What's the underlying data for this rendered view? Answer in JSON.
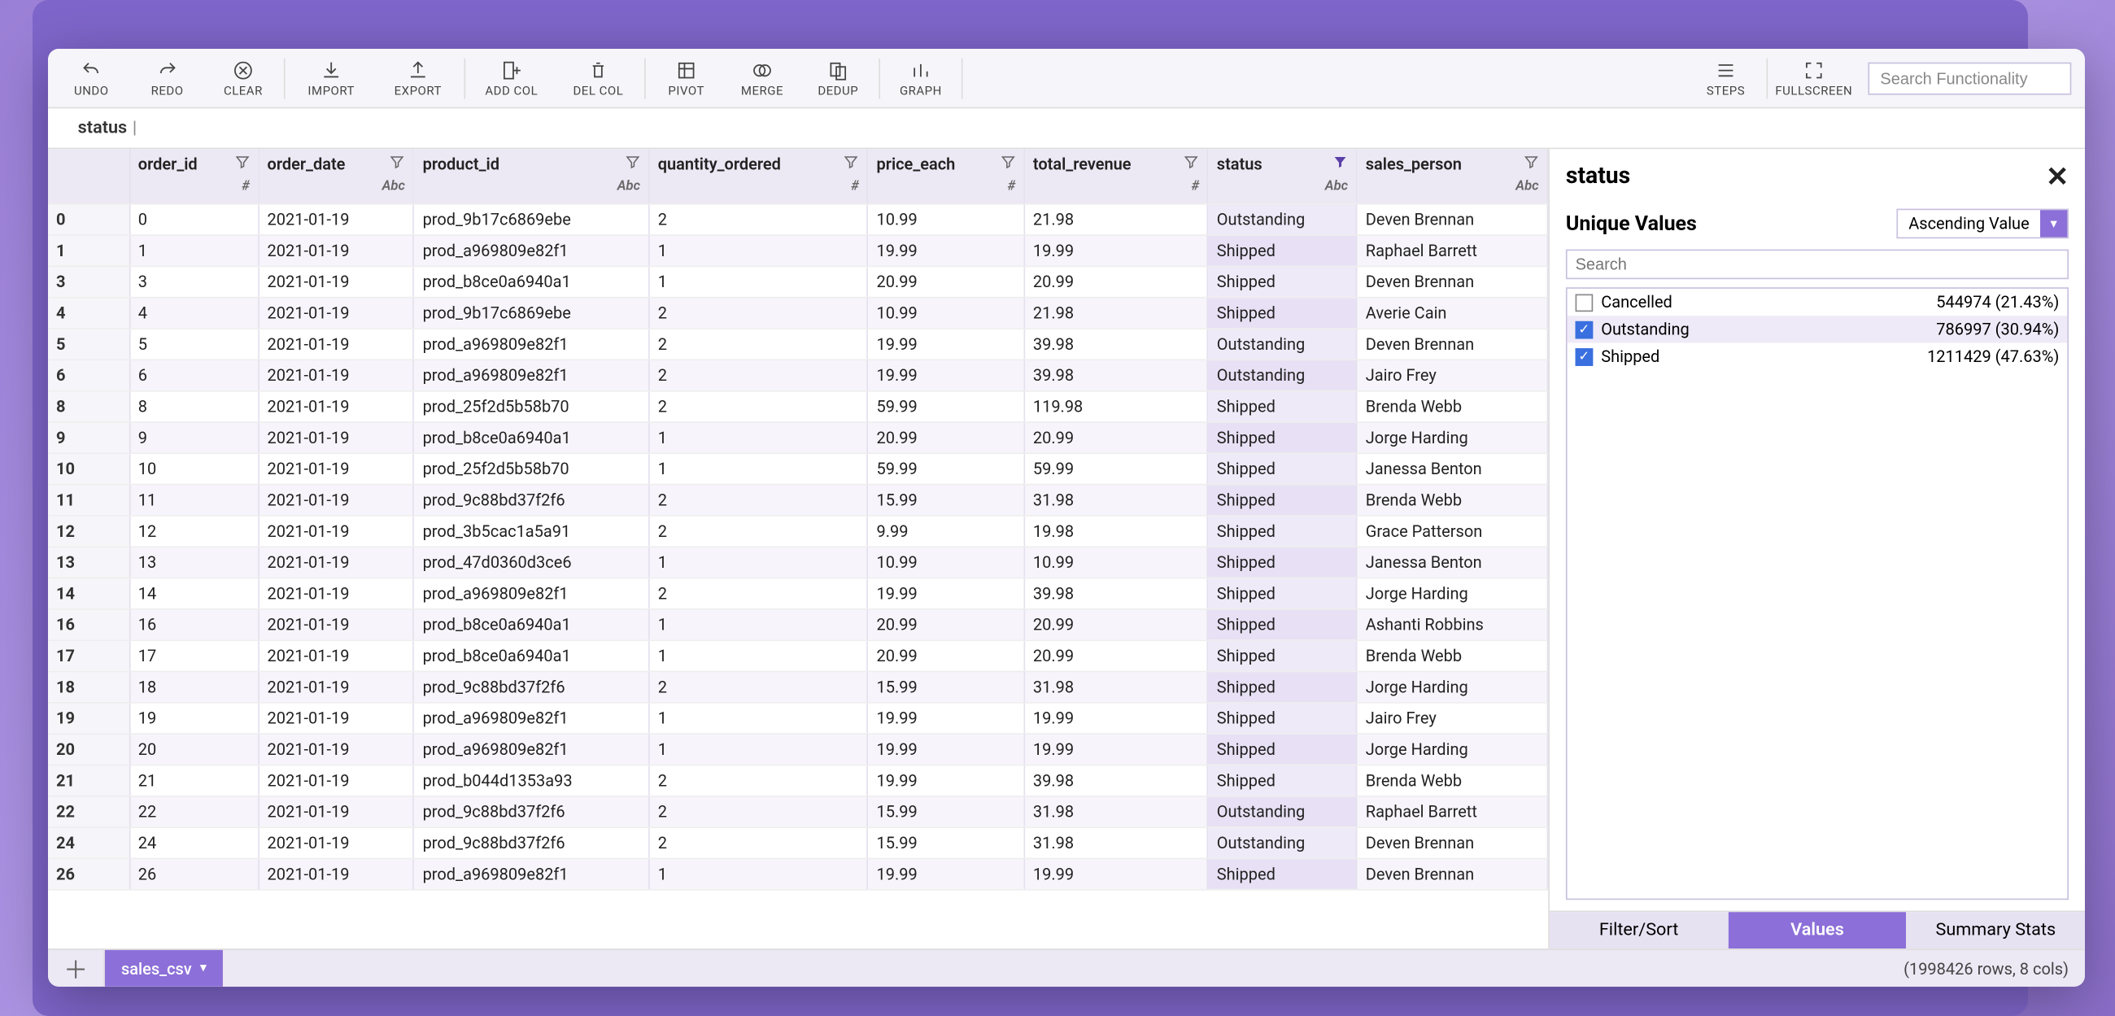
{
  "toolbar": {
    "undo": "UNDO",
    "redo": "REDO",
    "clear": "CLEAR",
    "import": "IMPORT",
    "export": "EXPORT",
    "add_col": "ADD COL",
    "del_col": "DEL COL",
    "pivot": "PIVOT",
    "merge": "MERGE",
    "dedup": "DEDUP",
    "graph": "GRAPH",
    "steps": "STEPS",
    "fullscreen": "FULLSCREEN",
    "search_placeholder": "Search Functionality"
  },
  "cell_editor": {
    "value": "status"
  },
  "columns": [
    {
      "name": "order_id",
      "type": "#"
    },
    {
      "name": "order_date",
      "type": "Abc"
    },
    {
      "name": "product_id",
      "type": "Abc"
    },
    {
      "name": "quantity_ordered",
      "type": "#"
    },
    {
      "name": "price_each",
      "type": "#"
    },
    {
      "name": "total_revenue",
      "type": "#"
    },
    {
      "name": "status",
      "type": "Abc",
      "highlight": true,
      "filtered": true
    },
    {
      "name": "sales_person",
      "type": "Abc"
    }
  ],
  "rows": [
    {
      "idx": "0",
      "cells": [
        "0",
        "2021-01-19",
        "prod_9b17c6869ebe",
        "2",
        "10.99",
        "21.98",
        "Outstanding",
        "Deven Brennan"
      ]
    },
    {
      "idx": "1",
      "cells": [
        "1",
        "2021-01-19",
        "prod_a969809e82f1",
        "1",
        "19.99",
        "19.99",
        "Shipped",
        "Raphael Barrett"
      ]
    },
    {
      "idx": "3",
      "cells": [
        "3",
        "2021-01-19",
        "prod_b8ce0a6940a1",
        "1",
        "20.99",
        "20.99",
        "Shipped",
        "Deven Brennan"
      ]
    },
    {
      "idx": "4",
      "cells": [
        "4",
        "2021-01-19",
        "prod_9b17c6869ebe",
        "2",
        "10.99",
        "21.98",
        "Shipped",
        "Averie Cain"
      ]
    },
    {
      "idx": "5",
      "cells": [
        "5",
        "2021-01-19",
        "prod_a969809e82f1",
        "2",
        "19.99",
        "39.98",
        "Outstanding",
        "Deven Brennan"
      ]
    },
    {
      "idx": "6",
      "cells": [
        "6",
        "2021-01-19",
        "prod_a969809e82f1",
        "2",
        "19.99",
        "39.98",
        "Outstanding",
        "Jairo Frey"
      ]
    },
    {
      "idx": "8",
      "cells": [
        "8",
        "2021-01-19",
        "prod_25f2d5b58b70",
        "2",
        "59.99",
        "119.98",
        "Shipped",
        "Brenda Webb"
      ]
    },
    {
      "idx": "9",
      "cells": [
        "9",
        "2021-01-19",
        "prod_b8ce0a6940a1",
        "1",
        "20.99",
        "20.99",
        "Shipped",
        "Jorge Harding"
      ]
    },
    {
      "idx": "10",
      "cells": [
        "10",
        "2021-01-19",
        "prod_25f2d5b58b70",
        "1",
        "59.99",
        "59.99",
        "Shipped",
        "Janessa Benton"
      ]
    },
    {
      "idx": "11",
      "cells": [
        "11",
        "2021-01-19",
        "prod_9c88bd37f2f6",
        "2",
        "15.99",
        "31.98",
        "Shipped",
        "Brenda Webb"
      ]
    },
    {
      "idx": "12",
      "cells": [
        "12",
        "2021-01-19",
        "prod_3b5cac1a5a91",
        "2",
        "9.99",
        "19.98",
        "Shipped",
        "Grace Patterson"
      ]
    },
    {
      "idx": "13",
      "cells": [
        "13",
        "2021-01-19",
        "prod_47d0360d3ce6",
        "1",
        "10.99",
        "10.99",
        "Shipped",
        "Janessa Benton"
      ]
    },
    {
      "idx": "14",
      "cells": [
        "14",
        "2021-01-19",
        "prod_a969809e82f1",
        "2",
        "19.99",
        "39.98",
        "Shipped",
        "Jorge Harding"
      ]
    },
    {
      "idx": "16",
      "cells": [
        "16",
        "2021-01-19",
        "prod_b8ce0a6940a1",
        "1",
        "20.99",
        "20.99",
        "Shipped",
        "Ashanti Robbins"
      ]
    },
    {
      "idx": "17",
      "cells": [
        "17",
        "2021-01-19",
        "prod_b8ce0a6940a1",
        "1",
        "20.99",
        "20.99",
        "Shipped",
        "Brenda Webb"
      ]
    },
    {
      "idx": "18",
      "cells": [
        "18",
        "2021-01-19",
        "prod_9c88bd37f2f6",
        "2",
        "15.99",
        "31.98",
        "Shipped",
        "Jorge Harding"
      ]
    },
    {
      "idx": "19",
      "cells": [
        "19",
        "2021-01-19",
        "prod_a969809e82f1",
        "1",
        "19.99",
        "19.99",
        "Shipped",
        "Jairo Frey"
      ]
    },
    {
      "idx": "20",
      "cells": [
        "20",
        "2021-01-19",
        "prod_a969809e82f1",
        "1",
        "19.99",
        "19.99",
        "Shipped",
        "Jorge Harding"
      ]
    },
    {
      "idx": "21",
      "cells": [
        "21",
        "2021-01-19",
        "prod_b044d1353a93",
        "2",
        "19.99",
        "39.98",
        "Shipped",
        "Brenda Webb"
      ]
    },
    {
      "idx": "22",
      "cells": [
        "22",
        "2021-01-19",
        "prod_9c88bd37f2f6",
        "2",
        "15.99",
        "31.98",
        "Outstanding",
        "Raphael Barrett"
      ]
    },
    {
      "idx": "24",
      "cells": [
        "24",
        "2021-01-19",
        "prod_9c88bd37f2f6",
        "2",
        "15.99",
        "31.98",
        "Outstanding",
        "Deven Brennan"
      ]
    },
    {
      "idx": "26",
      "cells": [
        "26",
        "2021-01-19",
        "prod_a969809e82f1",
        "1",
        "19.99",
        "19.99",
        "Shipped",
        "Deven Brennan"
      ]
    }
  ],
  "side_panel": {
    "title": "status",
    "section_title": "Unique Values",
    "sort_label": "Ascending Value",
    "search_placeholder": "Search",
    "values": [
      {
        "label": "Cancelled",
        "count": "544974 (21.43%)",
        "checked": false
      },
      {
        "label": "Outstanding",
        "count": "786997 (30.94%)",
        "checked": true
      },
      {
        "label": "Shipped",
        "count": "1211429 (47.63%)",
        "checked": true
      }
    ],
    "tabs": {
      "filter_sort": "Filter/Sort",
      "values": "Values",
      "summary": "Summary Stats",
      "active": "values"
    }
  },
  "footer": {
    "sheet_name": "sales_csv",
    "dims": "(1998426 rows, 8 cols)"
  }
}
